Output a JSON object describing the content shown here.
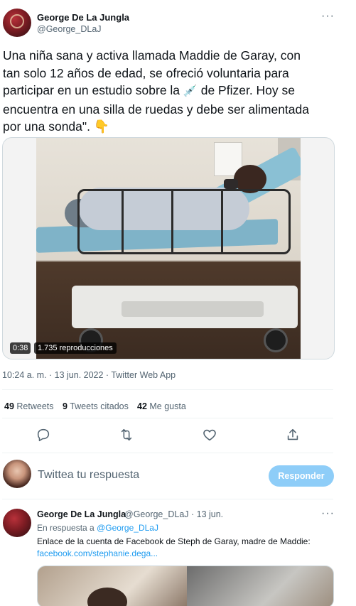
{
  "tweet": {
    "author_name": "George De La Jungla",
    "author_handle": "@George_DLaJ",
    "more": "···",
    "text_line1": "Una niña sana y activa llamada Maddie de Garay, con",
    "text_line2": "tan solo 12 años de edad, se ofreció voluntaria para",
    "text_line3a": "participar en un estudio sobre la",
    "syringe_emoji": "💉",
    "text_line3b": "de Pfizer. Hoy se",
    "text_line4": "encuentra en una silla de ruedas y debe ser alimentada",
    "text_line5": "por una sonda\".",
    "hand_emoji": "👇",
    "video_time": "0:38",
    "video_views": "1.735 reproducciones",
    "meta": "10:24 a. m. · 13 jun. 2022 · Twitter Web App"
  },
  "stats": {
    "retweets_num": "49",
    "retweets_label": "Retweets",
    "quotes_num": "9",
    "quotes_label": "Tweets citados",
    "likes_num": "42",
    "likes_label": "Me gusta"
  },
  "actions": {
    "icons": [
      "reply-icon",
      "retweet-icon",
      "like-icon",
      "share-icon"
    ]
  },
  "reply_box": {
    "placeholder": "Twittea tu respuesta",
    "button": "Responder"
  },
  "reply_tweet": {
    "author_name": "George De La Jungla",
    "handle_date": "@George_DLaJ · 13 jun.",
    "more": "···",
    "in_reply_prefix": "En respuesta a",
    "in_reply_handle": "@George_DLaJ",
    "text": "Enlace de la cuenta de Facebook de Steph de Garay, madre de Maddie:",
    "link": "facebook.com/stephanie.dega..."
  },
  "colors": {
    "accent": "#1d9bf0",
    "reply_button_bg": "#8ecdf8",
    "secondary_text": "#536471"
  }
}
